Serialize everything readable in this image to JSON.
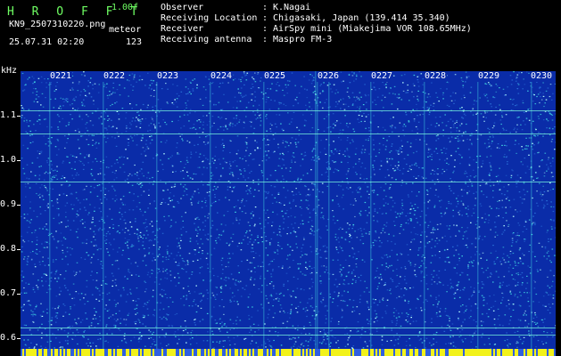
{
  "header": {
    "app_name": "H R O F F T",
    "version": "1.00f",
    "filename": "KN9_2507310220.png",
    "timestamp": "25.07.31 02:20",
    "meteor_label": "meteor",
    "meteor_count": "123"
  },
  "meta": [
    {
      "key": "Observer",
      "sep": ":",
      "value": "K.Nagai"
    },
    {
      "key": "Receiving Location",
      "sep": ":",
      "value": "Chigasaki, Japan (139.414 35.340)"
    },
    {
      "key": "Receiver",
      "sep": ":",
      "value": "AirSpy mini (Miakejima VOR 108.65MHz)"
    },
    {
      "key": "Receiving antenna",
      "sep": ":",
      "value": "Maspro FM-3"
    }
  ],
  "axis": {
    "unit": "kHz",
    "y_labels": [
      "1.1",
      "1.0",
      "0.9",
      "0.8",
      "0.7",
      "0.6"
    ],
    "time_labels": [
      "0221",
      "0222",
      "0223",
      "0224",
      "0225",
      "0226",
      "0227",
      "0228",
      "0229",
      "0230"
    ]
  },
  "colors": {
    "background": "#0a2ca8",
    "accent_green": "#6fff63",
    "noise_cyan": "#3fd0e0",
    "bar_yellow": "#f2f21a"
  }
}
